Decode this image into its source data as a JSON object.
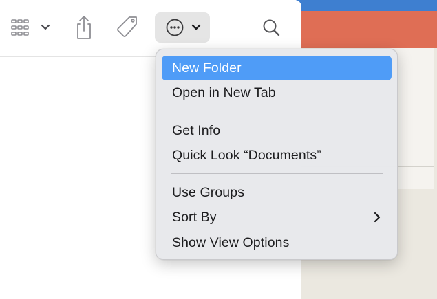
{
  "toolbar": {
    "view_icon": "icon-grid-view",
    "share_icon": "share-icon",
    "tag_icon": "tag-icon",
    "action_icon": "ellipsis-circle-icon",
    "search_icon": "search-icon"
  },
  "menu": {
    "items": [
      {
        "label": "New Folder",
        "highlighted": true
      },
      {
        "label": "Open in New Tab"
      },
      {
        "label": "Get Info"
      },
      {
        "label": "Quick Look “Documents”"
      },
      {
        "label": "Use Groups"
      },
      {
        "label": "Sort By",
        "submenu": true
      },
      {
        "label": "Show View Options"
      }
    ]
  },
  "colors": {
    "highlight": "#4f9cf7",
    "menu_bg": "#e8e9ec",
    "background_orange": "#df6e55",
    "background_blue": "#3e7fd0"
  }
}
